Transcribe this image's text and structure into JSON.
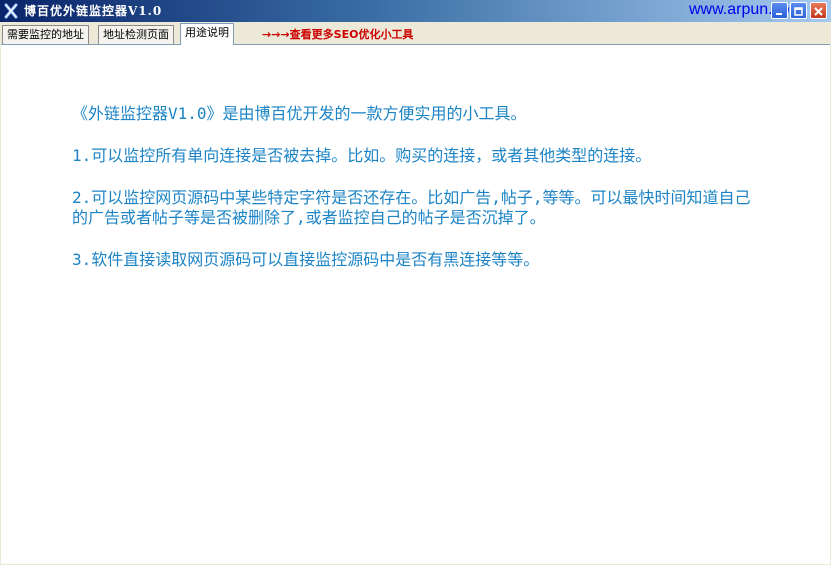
{
  "window": {
    "title": "博百优外链监控器V1.0",
    "site_link": "www.arpun.com"
  },
  "tabs": [
    {
      "label": "需要监控的地址",
      "active": false
    },
    {
      "label": "地址检测页面",
      "active": false
    },
    {
      "label": "用途说明",
      "active": true
    }
  ],
  "promo": {
    "label": "→→→查看更多SEO优化小工具"
  },
  "content": {
    "paragraphs": [
      "《外链监控器V1.0》是由博百优开发的一款方便实用的小工具。",
      "1.可以监控所有单向连接是否被去掉。比如。购买的连接，或者其他类型的连接。",
      "2.可以监控网页源码中某些特定字符是否还存在。比如广告,帖子,等等。可以最快时间知道自己的广告或者帖子等是否被删除了,或者监控自己的帖子是否沉掉了。",
      "3.软件直接读取网页源码可以直接监控源码中是否有黑连接等等。"
    ]
  },
  "colors": {
    "content_text": "#1c84c6",
    "promo_text": "#cc0000",
    "site_link": "#0000ee"
  },
  "icons": {
    "app": "x-logo-icon",
    "minimize": "minimize-icon",
    "maximize": "maximize-icon",
    "close": "close-icon"
  }
}
